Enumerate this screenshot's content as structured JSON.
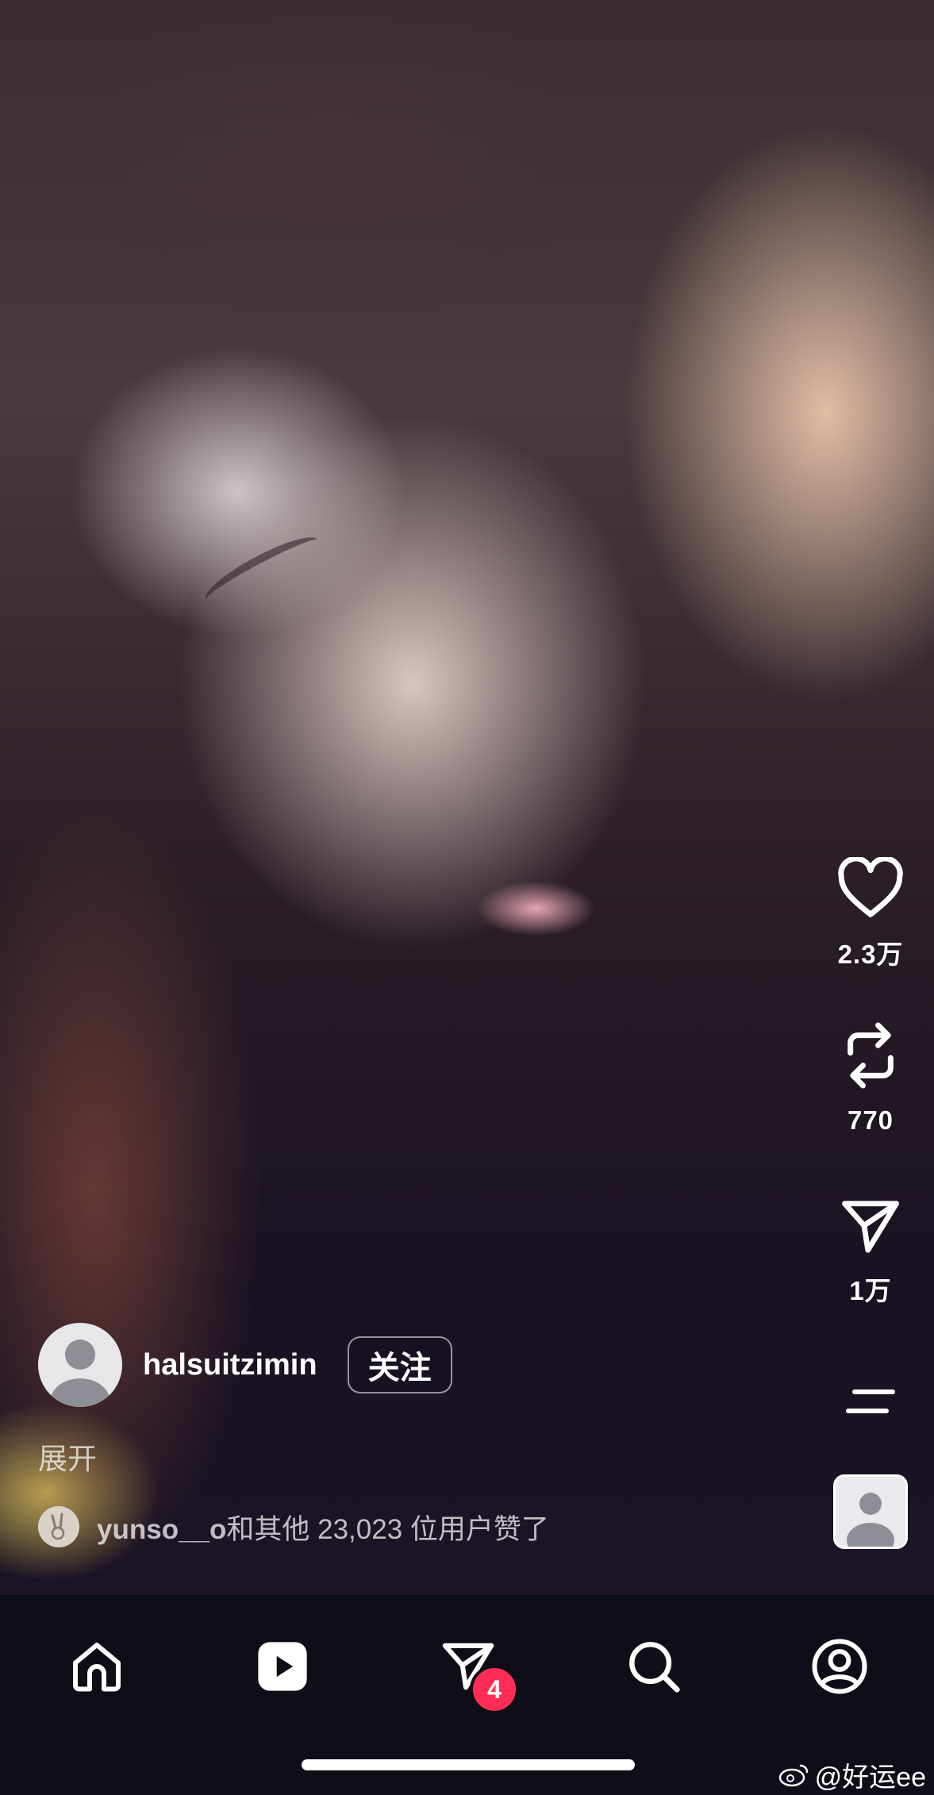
{
  "post": {
    "username": "halsuitzimin",
    "follow_label": "关注",
    "expand_label": "展开",
    "liked_by_user": "yunso__o",
    "liked_by_suffix": "和其他 23,023 位用户赞了"
  },
  "actions": {
    "likes": "2.3万",
    "reposts": "770",
    "shares": "1万",
    "icons": [
      "heart-icon",
      "repost-icon",
      "send-icon",
      "more-icon",
      "audio-icon"
    ]
  },
  "nav": {
    "items": [
      "home-icon",
      "reels-icon",
      "inbox-icon",
      "search-icon",
      "profile-icon"
    ],
    "inbox_badge": "4"
  },
  "watermark": "@好运ee",
  "colors": {
    "badge": "#ff2d55",
    "navbar_bg": "#0d0e17"
  }
}
